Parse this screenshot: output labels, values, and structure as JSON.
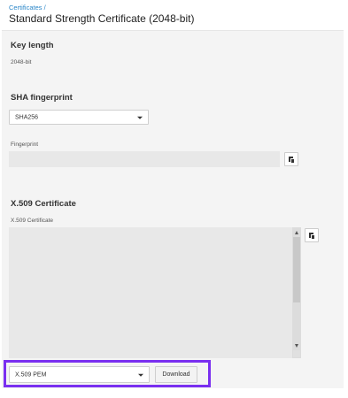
{
  "header": {
    "breadcrumb": "Certificates /",
    "title": "Standard Strength Certificate (2048-bit)"
  },
  "key_length": {
    "title": "Key length",
    "value": "2048-bit"
  },
  "sha": {
    "title": "SHA fingerprint",
    "select_value": "SHA256",
    "fingerprint_label": "Fingerprint",
    "fingerprint_value": ""
  },
  "x509": {
    "title": "X.509 Certificate",
    "textarea_label": "X.509 Certificate",
    "textarea_value": ""
  },
  "export": {
    "format_value": "X.509 PEM",
    "download_label": "Download"
  },
  "icons": {
    "copy": "copy-icon",
    "dropdown": "chevron-down-icon"
  },
  "colors": {
    "link": "#2a86c8",
    "highlight": "#7a2ff0"
  }
}
